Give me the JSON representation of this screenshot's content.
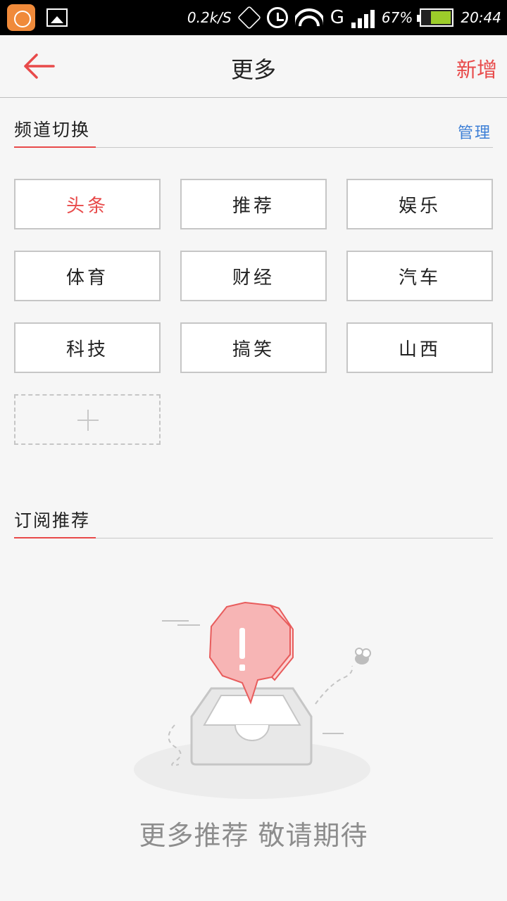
{
  "status_bar": {
    "speed": "0.2k/S",
    "network": "G",
    "battery": "67%",
    "time": "20:44"
  },
  "header": {
    "title": "更多",
    "add_label": "新增"
  },
  "channel_section": {
    "title": "频道切换",
    "manage_label": "管理",
    "channels": [
      "头条",
      "推荐",
      "娱乐",
      "体育",
      "财经",
      "汽车",
      "科技",
      "搞笑",
      "山西"
    ],
    "active_channel": "头条"
  },
  "subscribe_section": {
    "title": "订阅推荐",
    "empty_message": "更多推荐 敬请期待"
  },
  "colors": {
    "accent": "#e84a4a",
    "link": "#3d7fd6"
  }
}
